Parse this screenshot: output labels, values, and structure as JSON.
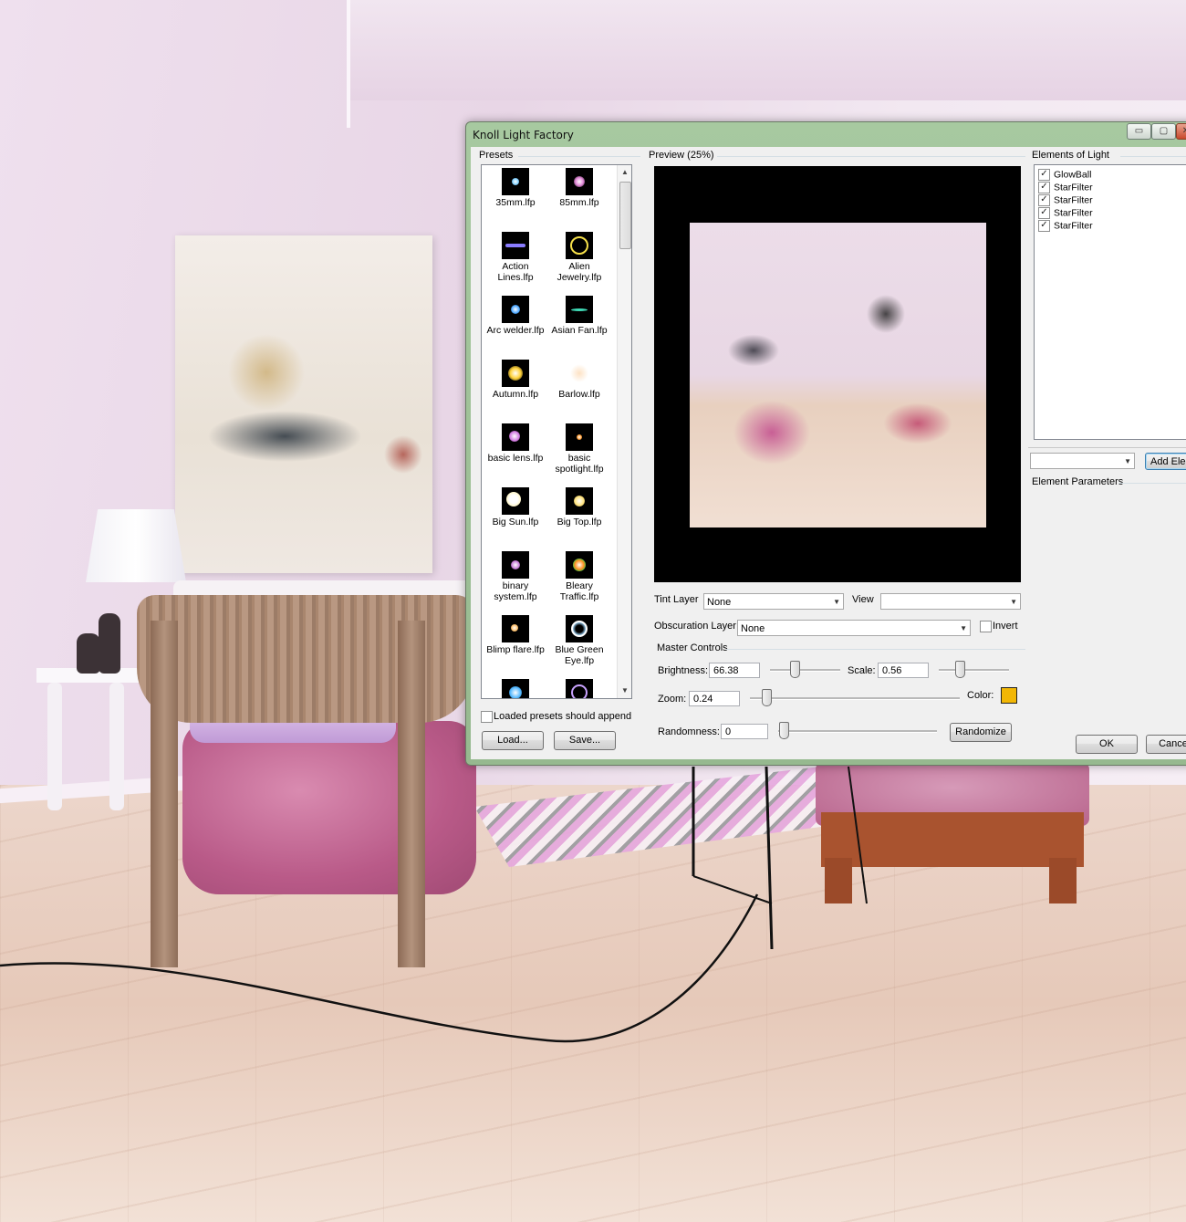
{
  "dialog": {
    "title": "Knoll Light Factory",
    "window_buttons": {
      "minimize": "▭",
      "maximize": "▢",
      "close": "✕"
    }
  },
  "presets": {
    "label": "Presets",
    "items": [
      {
        "label": "35mm.lfp"
      },
      {
        "label": "85mm.lfp"
      },
      {
        "label": "Action Lines.lfp"
      },
      {
        "label": "Alien Jewelry.lfp"
      },
      {
        "label": "Arc welder.lfp"
      },
      {
        "label": "Asian Fan.lfp"
      },
      {
        "label": "Autumn.lfp"
      },
      {
        "label": "Barlow.lfp"
      },
      {
        "label": "basic lens.lfp"
      },
      {
        "label": "basic spotlight.lfp"
      },
      {
        "label": "Big Sun.lfp"
      },
      {
        "label": "Big Top.lfp"
      },
      {
        "label": "binary system.lfp"
      },
      {
        "label": "Bleary Traffic.lfp"
      },
      {
        "label": "Blimp flare.lfp"
      },
      {
        "label": "Blue Green Eye.lfp"
      }
    ],
    "append_label": "Loaded presets should append",
    "append_checked": false,
    "load_label": "Load...",
    "save_label": "Save..."
  },
  "preview": {
    "label": "Preview (25%)",
    "tint_layer_label": "Tint Layer",
    "tint_layer_value": "None",
    "view_label": "View",
    "view_value": "",
    "obscuration_label": "Obscuration Layer",
    "obscuration_value": "None",
    "invert_label": "Invert",
    "invert_checked": false
  },
  "master_controls": {
    "label": "Master Controls",
    "brightness_label": "Brightness:",
    "brightness_value": "66.38",
    "scale_label": "Scale:",
    "scale_value": "0.56",
    "zoom_label": "Zoom:",
    "zoom_value": "0.24",
    "color_label": "Color:",
    "color_value": "#f2b705",
    "randomness_label": "Randomness:",
    "randomness_value": "0",
    "randomize_label": "Randomize"
  },
  "elements": {
    "label": "Elements of Light",
    "items": [
      {
        "label": "GlowBall",
        "checked": true
      },
      {
        "label": "StarFilter",
        "checked": true
      },
      {
        "label": "StarFilter",
        "checked": true
      },
      {
        "label": "StarFilter",
        "checked": true
      },
      {
        "label": "StarFilter",
        "checked": true
      }
    ],
    "add_label": "Add Elem",
    "dropdown_value": "",
    "parameters_label": "Element Parameters"
  },
  "footer": {
    "ok_label": "OK",
    "cancel_label": "Cance"
  }
}
